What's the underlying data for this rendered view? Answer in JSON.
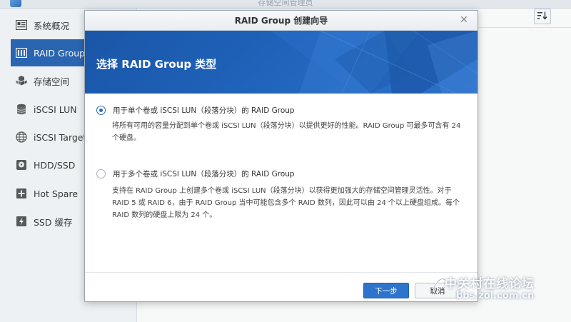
{
  "app": {
    "window_title": "存储空间管理员",
    "sidebar": {
      "items": [
        {
          "label": "系统概况",
          "icon": "overview-icon",
          "active": false
        },
        {
          "label": "RAID Group",
          "icon": "raid-icon",
          "active": true
        },
        {
          "label": "存储空间",
          "icon": "storage-icon",
          "active": false
        },
        {
          "label": "iSCSI LUN",
          "icon": "database-icon",
          "active": false
        },
        {
          "label": "iSCSI Target",
          "icon": "globe-icon",
          "active": false
        },
        {
          "label": "HDD/SSD",
          "icon": "disk-icon",
          "active": false
        },
        {
          "label": "Hot Spare",
          "icon": "plus-box-icon",
          "active": false
        },
        {
          "label": "SSD 缓存",
          "icon": "bolt-icon",
          "active": false
        }
      ]
    }
  },
  "dialog": {
    "title": "RAID Group 创建向导",
    "banner_title": "选择 RAID Group 类型",
    "options": [
      {
        "label": "用于单个卷或 iSCSI LUN（段落分块）的 RAID Group",
        "checked": true,
        "description": "将所有可用的容量分配到单个卷或 iSCSI LUN（段落分块）以提供更好的性能。RAID Group 可最多可含有 24 个硬盘。"
      },
      {
        "label": "用于多个卷或 iSCSI LUN（段落分块）的 RAID Group",
        "checked": false,
        "description": "支持在 RAID Group 上创建多个卷或 iSCSI LUN（段落分块）以获得更加强大的存储空间管理灵活性。对于RAID 5 或 RAID 6，由于 RAID Group 当中可能包含多个 RAID 数列，因此可以由 24 个以上硬盘组成。每个 RAID 数列的硬盘上限为 24 个。"
      }
    ],
    "buttons": {
      "next": "下一步",
      "cancel": "取消"
    }
  },
  "watermark": {
    "line1": "中关村在线论坛",
    "line2": "bbs.zol.com.cn"
  },
  "colors": {
    "accent": "#2663b4",
    "banner": "#1f62b9",
    "button_primary": "#2e73cc"
  }
}
